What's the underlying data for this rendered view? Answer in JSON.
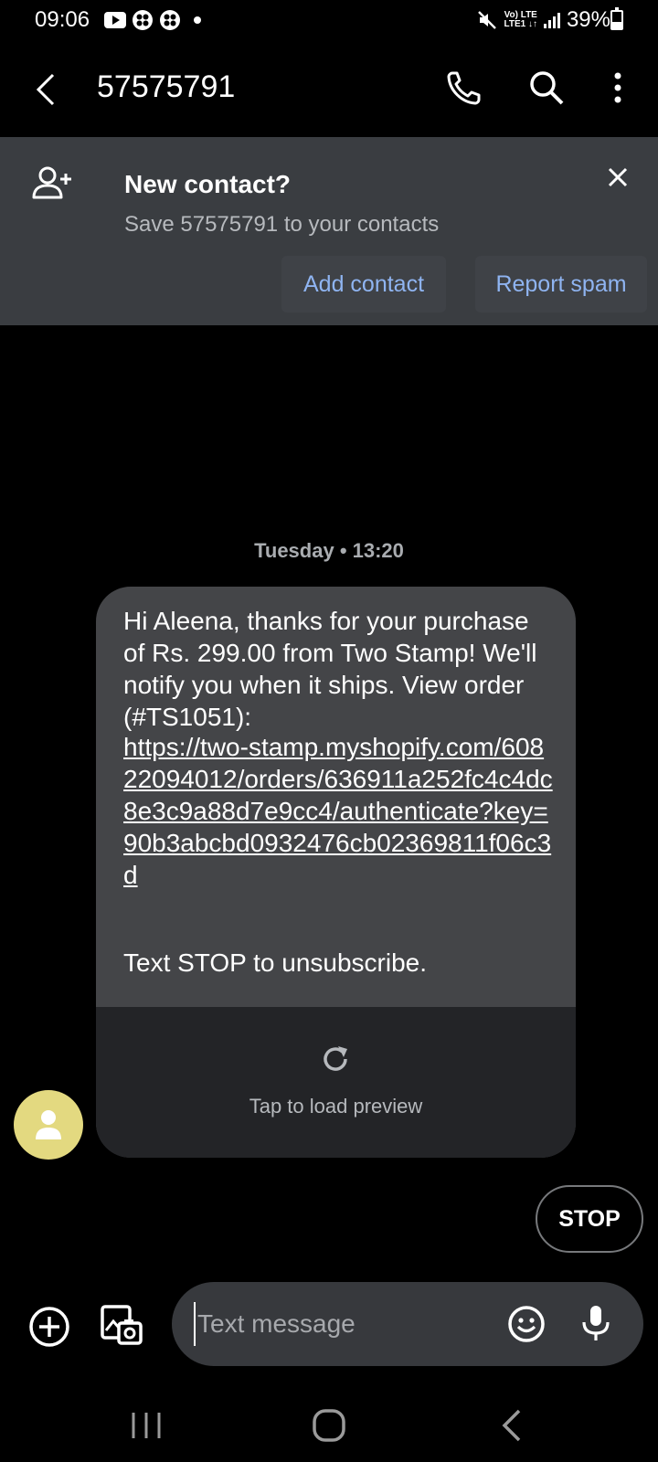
{
  "status_bar": {
    "time": "09:06",
    "network_top": "Vo) LTE",
    "network_bottom": "LTE1 ↓↑",
    "battery": "39%",
    "icons": [
      "youtube-icon",
      "clover-icon",
      "clover-icon",
      "dot-icon",
      "mute-icon",
      "signal-icon",
      "battery-icon"
    ]
  },
  "app_bar": {
    "title": "57575791",
    "icons": [
      "back-arrow-icon",
      "phone-icon",
      "search-icon",
      "more-vert-icon"
    ]
  },
  "banner": {
    "title": "New contact?",
    "subtitle": "Save 57575791 to your contacts",
    "add_contact": "Add contact",
    "report_spam": "Report spam",
    "icons": [
      "add-person-icon",
      "close-icon"
    ]
  },
  "conversation": {
    "date_label": "Tuesday • 13:20",
    "message": {
      "text": "Hi Aleena, thanks for your purchase of Rs. 299.00 from Two Stamp! We'll notify you when it ships. View order (#TS1051):",
      "link": "https://two-stamp.myshopify.com/60822094012/orders/636911a252fc4c4dc8e3c9a88d7e9cc4/authenticate?key=90b3abcbd0932476cb02369811f06c3d",
      "unsubscribe": "Text STOP to unsubscribe.",
      "preview_label": "Tap to load preview"
    },
    "quick_reply": "STOP",
    "accent_avatar_color": "#e3d980"
  },
  "composer": {
    "placeholder": "Text message",
    "icons": [
      "add-circle-icon",
      "gallery-camera-icon",
      "emoji-icon",
      "mic-icon"
    ]
  },
  "nav_bar": {
    "icons": [
      "recent-apps-icon",
      "home-icon",
      "back-icon"
    ]
  }
}
